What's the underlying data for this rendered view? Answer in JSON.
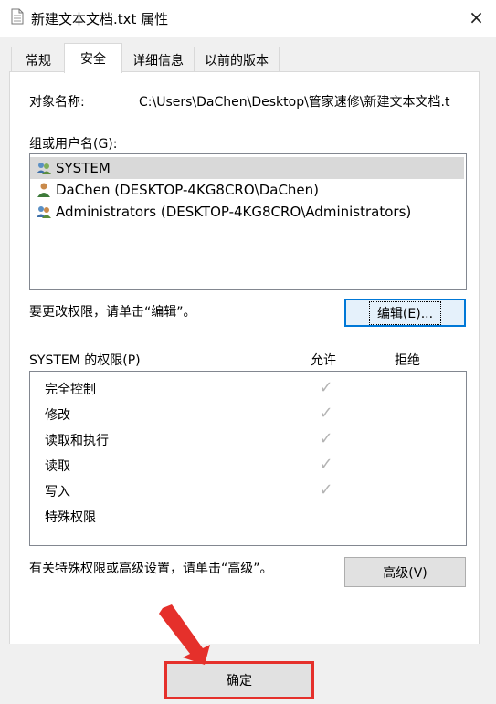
{
  "window": {
    "title": "新建文本文档.txt 属性",
    "close_icon": "×"
  },
  "tabs": [
    {
      "label": "常规",
      "active": false
    },
    {
      "label": "安全",
      "active": true
    },
    {
      "label": "详细信息",
      "active": false
    },
    {
      "label": "以前的版本",
      "active": false
    }
  ],
  "security": {
    "object_name_label": "对象名称:",
    "object_name_value": "C:\\Users\\DaChen\\Desktop\\管家速修\\新建文本文档.t",
    "groups_label": "组或用户名(G):",
    "groups": [
      {
        "name": "SYSTEM",
        "icon": "user-group-icon",
        "selected": true
      },
      {
        "name": "DaChen (DESKTOP-4KG8CRO\\DaChen)",
        "icon": "user-icon",
        "selected": false
      },
      {
        "name": "Administrators (DESKTOP-4KG8CRO\\Administrators)",
        "icon": "user-group-icon",
        "selected": false
      }
    ],
    "change_hint": "要更改权限，请单击“编辑”。",
    "edit_button": "编辑(E)...",
    "permissions_label": "SYSTEM 的权限(P)",
    "allow_header": "允许",
    "deny_header": "拒绝",
    "permissions": [
      {
        "name": "完全控制",
        "allow": true,
        "deny": false
      },
      {
        "name": "修改",
        "allow": true,
        "deny": false
      },
      {
        "name": "读取和执行",
        "allow": true,
        "deny": false
      },
      {
        "name": "读取",
        "allow": true,
        "deny": false
      },
      {
        "name": "写入",
        "allow": true,
        "deny": false
      },
      {
        "name": "特殊权限",
        "allow": false,
        "deny": false
      }
    ],
    "advanced_hint": "有关特殊权限或高级设置，请单击“高级”。",
    "advanced_button": "高级(V)"
  },
  "footer": {
    "ok_button": "确定"
  },
  "colors": {
    "annotation_red": "#e5302b",
    "focus_blue": "#0078d7",
    "check_gray": "#b4b4b4"
  }
}
